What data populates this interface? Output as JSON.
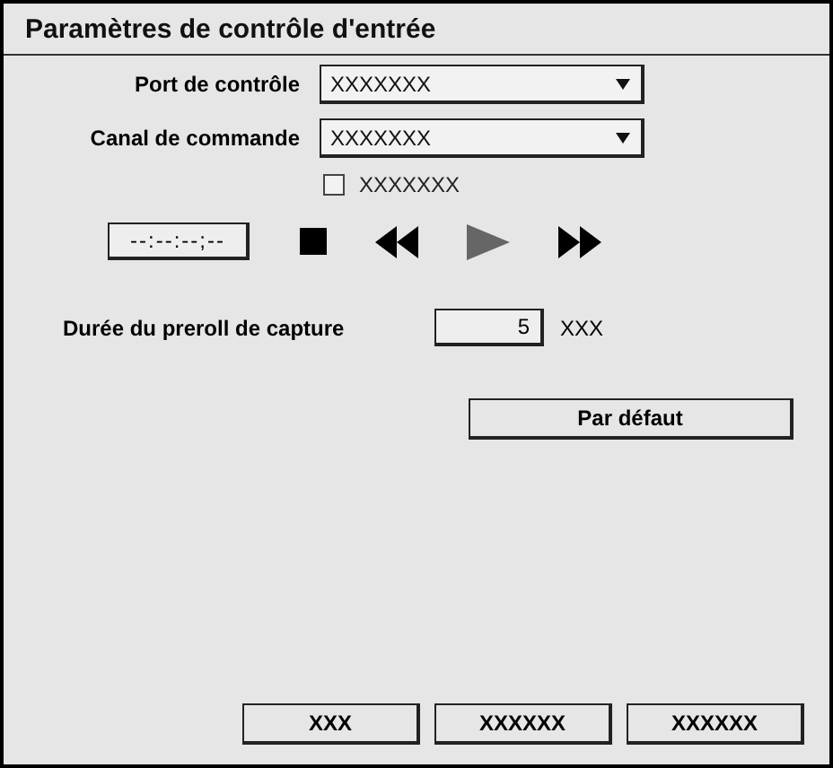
{
  "window": {
    "title": "Paramètres de contrôle d'entrée"
  },
  "fields": [
    {
      "label": "Port de contrôle",
      "value": "XXXXXXX"
    },
    {
      "label": "Canal de commande",
      "value": "XXXXXXX"
    }
  ],
  "checkbox": {
    "label": "XXXXXXX",
    "checked": false
  },
  "timecode": {
    "value": "--:--:--;--"
  },
  "transport": [
    {
      "kind": "stop",
      "disabled": false
    },
    {
      "kind": "rewind",
      "disabled": false
    },
    {
      "kind": "play",
      "disabled": true
    },
    {
      "kind": "fast_forward",
      "disabled": false
    }
  ],
  "preroll": {
    "label": "Durée du preroll de capture",
    "value": "5",
    "unit": "XXX"
  },
  "default_button": "Par défaut",
  "buttons": [
    "XXX",
    "XXXXXX",
    "XXXXXX"
  ]
}
